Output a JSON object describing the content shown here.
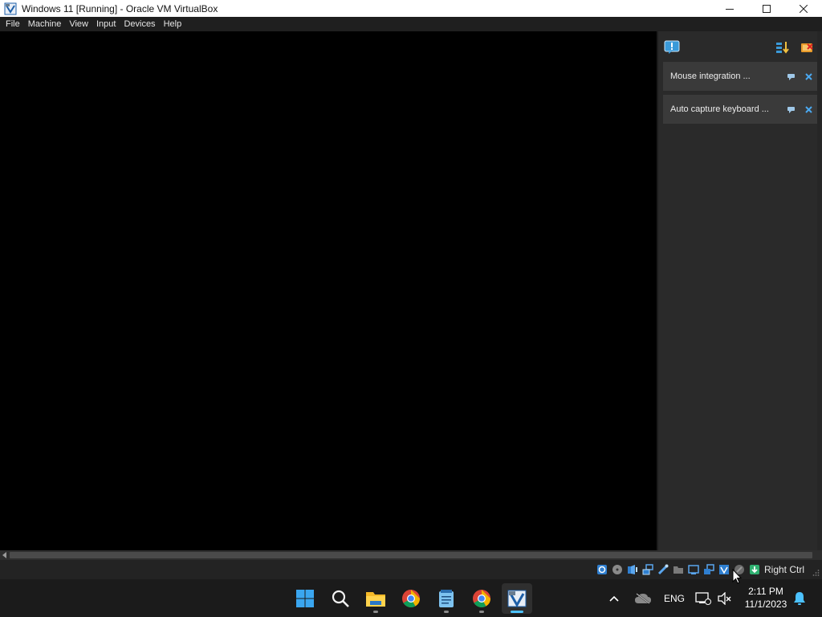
{
  "window": {
    "title": "Windows 11 [Running] - Oracle VM VirtualBox"
  },
  "menu": {
    "items": [
      "File",
      "Machine",
      "View",
      "Input",
      "Devices",
      "Help"
    ]
  },
  "notifications": {
    "items": [
      {
        "label": "Mouse integration ..."
      },
      {
        "label": "Auto capture keyboard ..."
      }
    ]
  },
  "statusbar": {
    "host_key": "Right Ctrl"
  },
  "taskbar": {
    "language": "ENG",
    "time": "2:11 PM",
    "date": "11/1/2023"
  },
  "colors": {
    "accent": "#4cc2ff",
    "panel": "#2a2a2a",
    "menubar": "#1f1f1f"
  }
}
